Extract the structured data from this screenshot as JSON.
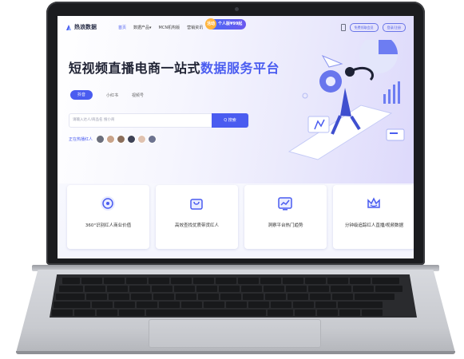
{
  "nav": {
    "logo_text": "热浪数据",
    "links": [
      "首页",
      "数据产品▾",
      "MCN机构版",
      "营销资讯"
    ],
    "active_link": "首页",
    "promo_badge": "活动",
    "promo_text": "个人版¥99起",
    "buttons": [
      "免费领取会员",
      "登录/注册"
    ]
  },
  "hero": {
    "headline_main": "短视频直播电商一站式",
    "headline_highlight": "数据服务平台",
    "tabs": [
      "抖音",
      "小红书",
      "视频号"
    ],
    "active_tab": "抖音",
    "search_placeholder": "请输入达人/商品名 搜小商",
    "search_button": "Q 搜索",
    "hot_label": "正在热播红人"
  },
  "cards": [
    {
      "label": "360°识别红人商业价值",
      "icon": "target-icon"
    },
    {
      "label": "高效查找优质带货红人",
      "icon": "shopping-bag-icon"
    },
    {
      "label": "洞察平台热门趋势",
      "icon": "trend-chart-icon"
    },
    {
      "label": "分钟级追踪红人直播/视频数据",
      "icon": "crown-icon"
    }
  ],
  "colors": {
    "accent": "#4a5cf0",
    "headline": "#1f2233"
  }
}
